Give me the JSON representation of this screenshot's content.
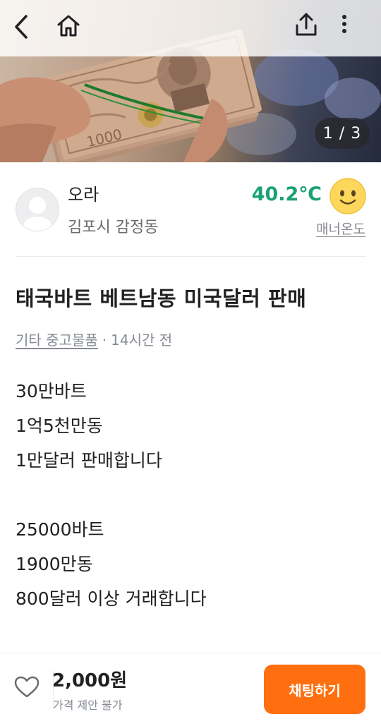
{
  "image": {
    "page_indicator": "1 / 3",
    "banknote_denomination": "1000"
  },
  "toolbar": {
    "back_icon": "chevron-left-icon",
    "home_icon": "home-icon",
    "share_icon": "share-upload-icon",
    "more_icon": "more-vertical-icon"
  },
  "seller": {
    "name": "오라",
    "location": "김포시 감정동",
    "manner_temperature": "40.2℃",
    "manner_label": "매너온도",
    "temperature_color": "#1aa174"
  },
  "post": {
    "title": "태국바트 베트남동 미국달러 판매",
    "category": "기타 중고물품",
    "separator": "·",
    "time": "14시간 전",
    "content_lines": [
      "30만바트",
      "1억5천만동",
      "1만달러 판매합니다",
      "",
      "25000바트",
      "1900만동",
      "800달러 이상 거래합니다"
    ]
  },
  "bottom": {
    "price": "2,000원",
    "price_note": "가격 제안 불가",
    "chat_button": "채팅하기",
    "accent_color": "#ff6f0f"
  }
}
